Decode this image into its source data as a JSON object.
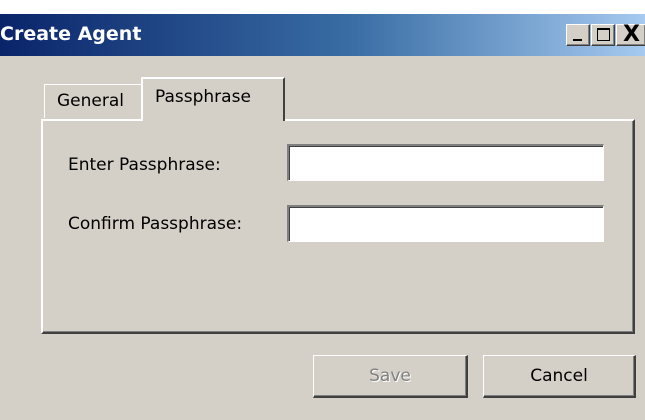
{
  "window": {
    "title": "Create Agent",
    "title_color": "#ffffff",
    "titlebar_gradient": [
      "#0a246a",
      "#a6caf0"
    ],
    "close_glyph": "X"
  },
  "tabs": [
    {
      "label": "General",
      "selected": false
    },
    {
      "label": "Passphrase",
      "selected": true
    }
  ],
  "form": {
    "enter_label": "Enter Passphrase:",
    "enter_value": "",
    "confirm_label": "Confirm Passphrase:",
    "confirm_value": ""
  },
  "buttons": {
    "save_label": "Save",
    "save_enabled": false,
    "cancel_label": "Cancel"
  }
}
